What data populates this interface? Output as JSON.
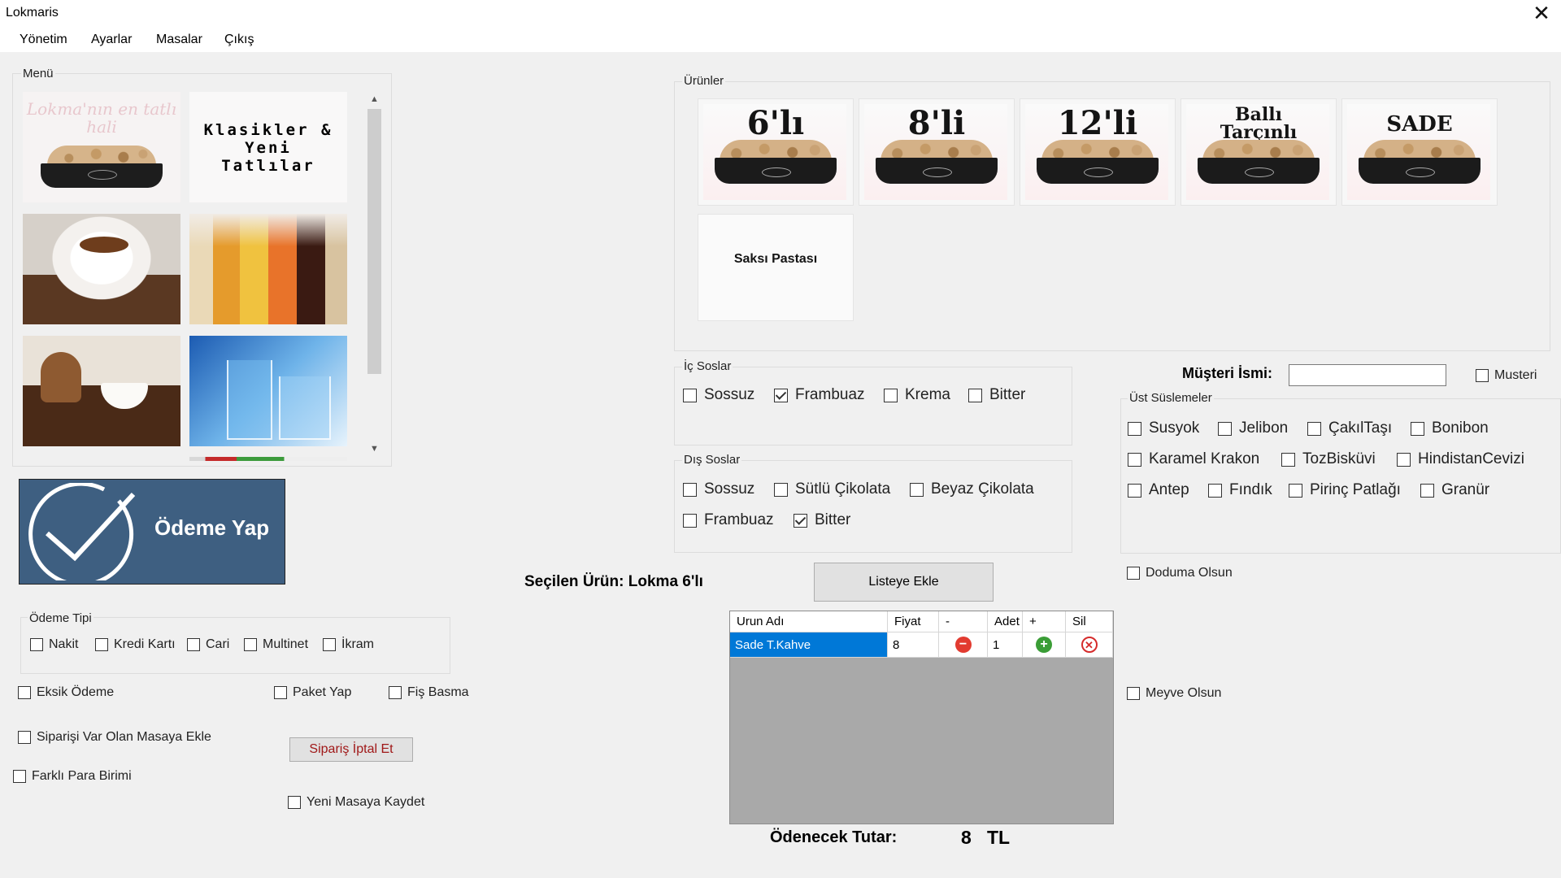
{
  "window": {
    "title": "Lokmaris"
  },
  "menubar": [
    "Yönetim",
    "Ayarlar",
    "Masalar",
    "Çıkış"
  ],
  "menu_panel": {
    "title": "Menü",
    "tiles": [
      {
        "icon": "lokma-dessert-image",
        "text": "Lokma'nın en tatlı hali"
      },
      {
        "icon": "classic-desserts-image",
        "text": "Klasikler & Yeni Tatlılar"
      },
      {
        "icon": "coffee-cup-image",
        "text": ""
      },
      {
        "icon": "cold-drinks-image",
        "text": ""
      },
      {
        "icon": "turkish-coffee-image",
        "text": ""
      },
      {
        "icon": "water-glass-image",
        "text": ""
      }
    ]
  },
  "pay_button": {
    "label": "Ödeme Yap"
  },
  "payment_type": {
    "title": "Ödeme Tipi",
    "options": [
      {
        "label": "Nakit",
        "checked": false
      },
      {
        "label": "Kredi Kartı",
        "checked": false
      },
      {
        "label": "Cari",
        "checked": false
      },
      {
        "label": "Multinet",
        "checked": false
      },
      {
        "label": "İkram",
        "checked": false
      }
    ]
  },
  "options_left": {
    "eksik_odeme": "Eksik Ödeme",
    "paket_yap": "Paket Yap",
    "fis_basma": "Fiş Basma",
    "siparisi_ekle": "Siparişi Var Olan Masaya Ekle",
    "siparis_iptal": "Sipariş İptal Et",
    "farkli_para": "Farklı Para Birimi",
    "yeni_masa": "Yeni Masaya Kaydet"
  },
  "products": {
    "title": "Ürünler",
    "items": [
      "6'lı",
      "8'li",
      "12'li",
      "Ballı Tarçınlı",
      "SADE",
      "Saksı Pastası"
    ]
  },
  "inner_sauces": {
    "title": "İç Soslar",
    "options": [
      {
        "label": "Sossuz",
        "checked": false
      },
      {
        "label": "Frambuaz",
        "checked": true
      },
      {
        "label": "Krema",
        "checked": false
      },
      {
        "label": "Bitter",
        "checked": false
      }
    ]
  },
  "outer_sauces": {
    "title": "Dış Soslar",
    "options": [
      {
        "label": "Sossuz",
        "checked": false
      },
      {
        "label": "Sütlü Çikolata",
        "checked": false
      },
      {
        "label": "Beyaz Çikolata",
        "checked": false
      },
      {
        "label": "Frambuaz",
        "checked": false
      },
      {
        "label": "Bitter",
        "checked": true
      }
    ]
  },
  "customer": {
    "label": "Müşteri İsmi:",
    "value": "",
    "musteri_checkbox": "Musteri"
  },
  "toppings": {
    "title": "Üst Süslemeler",
    "options": [
      {
        "label": "Susyok",
        "checked": false
      },
      {
        "label": "Jelibon",
        "checked": false
      },
      {
        "label": "ÇakılTaşı",
        "checked": false
      },
      {
        "label": "Bonibon",
        "checked": false
      },
      {
        "label": "Karamel Krakon",
        "checked": false
      },
      {
        "label": "TozBisküvi",
        "checked": false
      },
      {
        "label": "HindistanCevizi",
        "checked": false
      },
      {
        "label": "Antep",
        "checked": false
      },
      {
        "label": "Fındık",
        "checked": false
      },
      {
        "label": "Pirinç Patlağı",
        "checked": false
      },
      {
        "label": "Granür",
        "checked": false
      }
    ]
  },
  "extra_options": {
    "doduma": "Doduma Olsun",
    "meyve": "Meyve Olsun"
  },
  "selected_product": {
    "label": "Seçilen Ürün:",
    "value": "Lokma 6'lı"
  },
  "add_to_list_button": "Listeye Ekle",
  "order_grid": {
    "columns": [
      "Urun Adı",
      "Fiyat",
      "-",
      "Adet",
      "+",
      "Sil"
    ],
    "rows": [
      {
        "name": "Sade T.Kahve",
        "price": "8",
        "qty": "1"
      }
    ]
  },
  "total": {
    "label": "Ödenecek Tutar:",
    "value": "8",
    "currency": "TL"
  },
  "colors": {
    "pay_button_bg": "#3e5f81",
    "grid_selected": "#0078d7",
    "grid_bg": "#a9a9a9"
  }
}
